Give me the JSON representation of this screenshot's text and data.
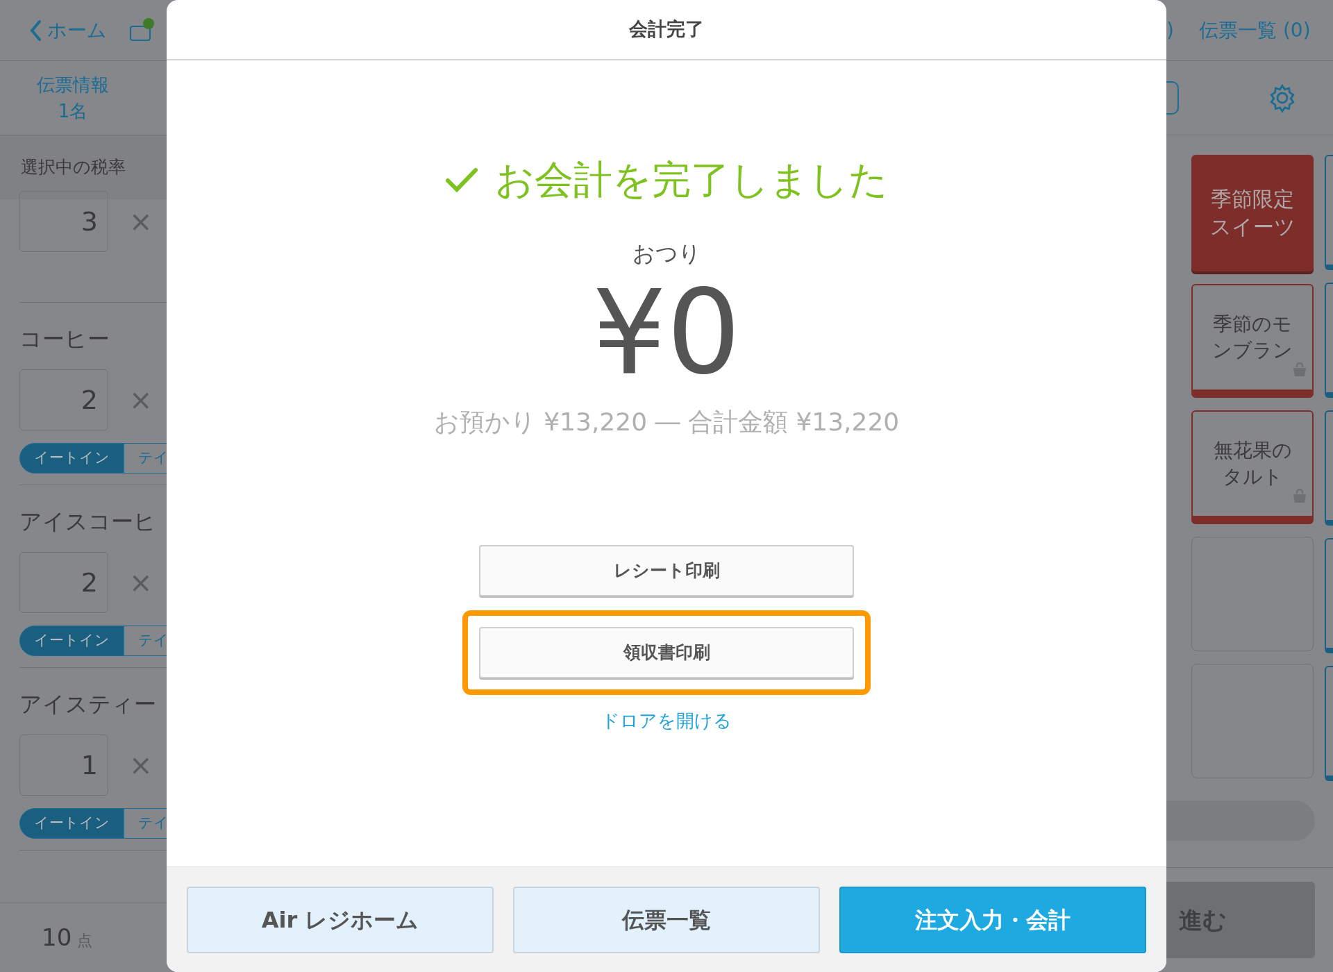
{
  "left_panel": {
    "back_link": "ホーム",
    "ticket_tab": {
      "title": "伝票情報",
      "guests": "1名"
    },
    "tax_label": "選択中の税率",
    "items": [
      {
        "quantity": "3",
        "times": "×"
      },
      {
        "name": "コーヒー",
        "quantity": "2",
        "times": "×",
        "modes": [
          {
            "label": "イートイン",
            "selected": true
          },
          {
            "label": "テイ",
            "selected": false
          }
        ]
      },
      {
        "name": "アイスコーヒ",
        "quantity": "2",
        "times": "×",
        "modes": [
          {
            "label": "イートイン",
            "selected": true
          },
          {
            "label": "テイ",
            "selected": false
          }
        ]
      },
      {
        "name": "アイスティー",
        "quantity": "1",
        "times": "×",
        "modes": [
          {
            "label": "イートイン",
            "selected": true
          },
          {
            "label": "テイ",
            "selected": false
          }
        ]
      }
    ],
    "total_count": "10",
    "count_unit": "点"
  },
  "dialog": {
    "title": "会計完了",
    "message": "お会計を完了しました",
    "change_label": "おつり",
    "change_amount": "¥0",
    "summary": "お預かり ¥13,220 ― 合計金額 ¥13,220",
    "actions": [
      {
        "label": "レシート印刷",
        "highlighted": false
      },
      {
        "label": "領収書印刷",
        "highlighted": true
      }
    ],
    "drawer_link": "ドロアを開ける",
    "footer_buttons": [
      {
        "label": "Air レジホーム",
        "primary": false
      },
      {
        "label": "伝票一覧",
        "primary": false
      },
      {
        "label": "注文入力・会計",
        "primary": true
      }
    ]
  },
  "right_panel": {
    "header_cut": ")",
    "ticket_list_link": "伝票一覧 (0)",
    "tiles": [
      {
        "kind": "category",
        "label": "季節限定スイーツ",
        "color": "#7d2e2b"
      },
      {
        "kind": "item",
        "label": "季節のモンブラン",
        "color": "#7d2e2b"
      },
      {
        "kind": "item",
        "label": "無花果のタルト",
        "color": "#7d2e2b"
      },
      {
        "kind": "empty"
      },
      {
        "kind": "empty"
      }
    ],
    "next_button": "進む"
  }
}
